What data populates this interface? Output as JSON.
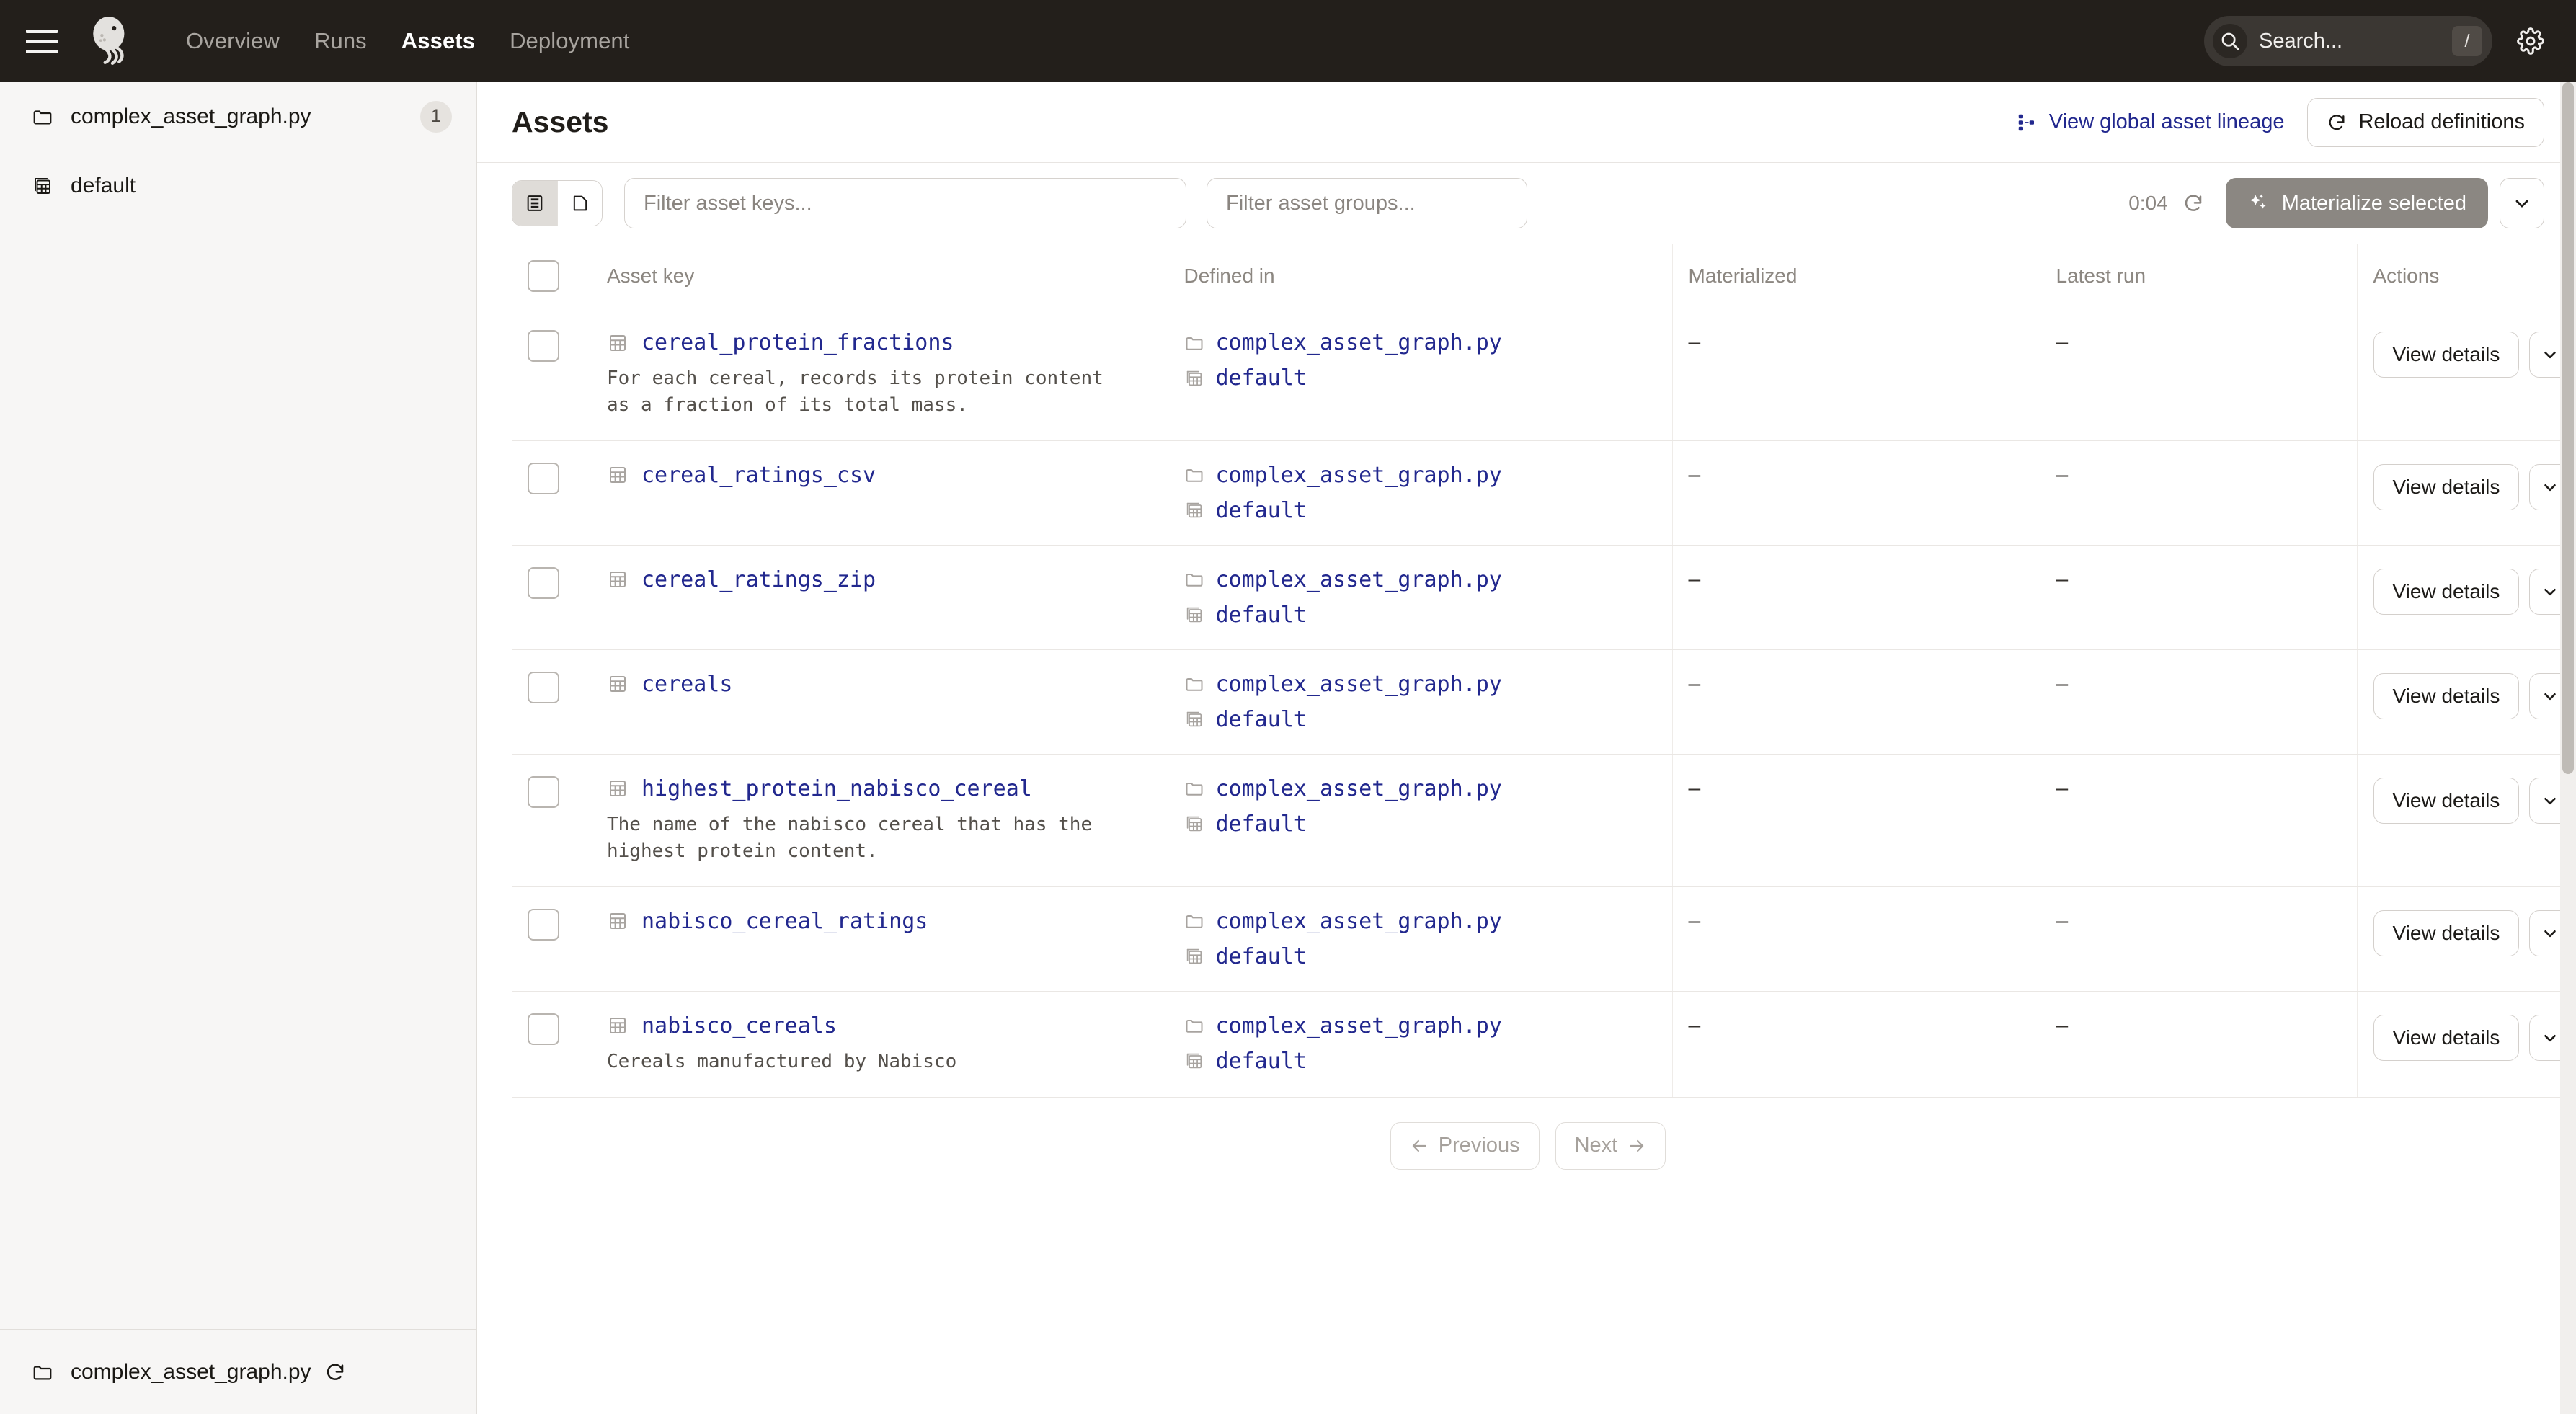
{
  "topnav": {
    "menu_icon": "hamburger-icon",
    "logo_icon": "dagster-logo",
    "links": [
      {
        "label": "Overview",
        "active": false
      },
      {
        "label": "Runs",
        "active": false
      },
      {
        "label": "Assets",
        "active": true
      },
      {
        "label": "Deployment",
        "active": false
      }
    ],
    "search": {
      "placeholder": "Search...",
      "shortcut": "/",
      "icon": "search-icon"
    },
    "settings_icon": "gear-icon",
    "background": "#231F1B"
  },
  "sidebar": {
    "items": [
      {
        "label": "complex_asset_graph.py",
        "icon": "folder-icon",
        "badge": "1"
      },
      {
        "label": "default",
        "icon": "asset-group-icon",
        "badge": ""
      }
    ],
    "footer": {
      "label": "complex_asset_graph.py",
      "icon": "folder-icon",
      "reload_icon": "refresh-icon"
    }
  },
  "page": {
    "title": "Assets",
    "lineage_link": "View global asset lineage",
    "lineage_icon": "lineage-icon",
    "reload_button": "Reload definitions",
    "reload_icon": "refresh-icon"
  },
  "toolbar": {
    "view_list_icon": "list-view-icon",
    "view_folder_icon": "folder-view-icon",
    "filter_keys_placeholder": "Filter asset keys...",
    "filter_groups_placeholder": "Filter asset groups...",
    "timer": "0:04",
    "timer_refresh_icon": "refresh-icon",
    "materialize_label": "Materialize selected",
    "materialize_icon": "sparkle-icon",
    "materialize_caret_icon": "chevron-down-icon",
    "accent_disabled": "#8B8782"
  },
  "table": {
    "columns": [
      "Asset key",
      "Defined in",
      "Materialized",
      "Latest run",
      "Actions"
    ],
    "empty_value": "–",
    "view_details_label": "View details",
    "row_caret_icon": "chevron-down-icon",
    "rows": [
      {
        "key": "cereal_protein_fractions",
        "description": "For each cereal, records its protein content as a fraction of its total mass.",
        "defined_file": "complex_asset_graph.py",
        "defined_group": "default",
        "materialized": "–",
        "latest_run": "–"
      },
      {
        "key": "cereal_ratings_csv",
        "description": "",
        "defined_file": "complex_asset_graph.py",
        "defined_group": "default",
        "materialized": "–",
        "latest_run": "–"
      },
      {
        "key": "cereal_ratings_zip",
        "description": "",
        "defined_file": "complex_asset_graph.py",
        "defined_group": "default",
        "materialized": "–",
        "latest_run": "–"
      },
      {
        "key": "cereals",
        "description": "",
        "defined_file": "complex_asset_graph.py",
        "defined_group": "default",
        "materialized": "–",
        "latest_run": "–"
      },
      {
        "key": "highest_protein_nabisco_cereal",
        "description": "The name of the nabisco cereal that has the highest protein content.",
        "defined_file": "complex_asset_graph.py",
        "defined_group": "default",
        "materialized": "–",
        "latest_run": "–"
      },
      {
        "key": "nabisco_cereal_ratings",
        "description": "",
        "defined_file": "complex_asset_graph.py",
        "defined_group": "default",
        "materialized": "–",
        "latest_run": "–"
      },
      {
        "key": "nabisco_cereals",
        "description": "Cereals manufactured by Nabisco",
        "defined_file": "complex_asset_graph.py",
        "defined_group": "default",
        "materialized": "–",
        "latest_run": "–"
      }
    ]
  },
  "pagination": {
    "previous": "Previous",
    "next": "Next",
    "prev_icon": "arrow-left-icon",
    "next_icon": "arrow-right-icon"
  }
}
